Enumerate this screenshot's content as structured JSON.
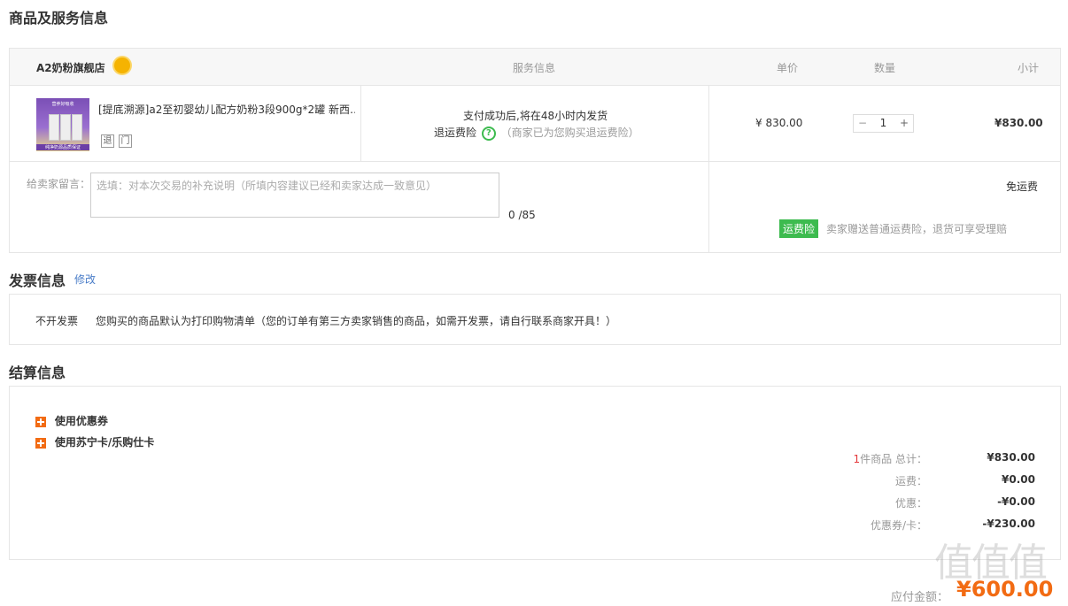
{
  "sections": {
    "goods_title": "商品及服务信息",
    "invoice_title": "发票信息",
    "invoice_edit": "修改",
    "settle_title": "结算信息"
  },
  "table": {
    "shop_name": "A2奶粉旗舰店",
    "col_service": "服务信息",
    "col_price": "单价",
    "col_qty": "数量",
    "col_subtotal": "小计"
  },
  "product": {
    "name": "[提底溯源]a2至初婴幼儿配方奶粉3段900g*2罐 新西…",
    "image_banner": "营养好吸收",
    "image_caption": "纯净奶源品质保证",
    "tag_return": "退",
    "tag_store": "门",
    "service_line1": "支付成功后,将在48小时内发货",
    "service_insurance_label": "退运费险",
    "service_insurance_note": "（商家已为您购买退运费险）",
    "unit_price": "¥ 830.00",
    "qty_minus": "−",
    "qty_value": "1",
    "qty_plus": "+",
    "subtotal": "¥830.00"
  },
  "message": {
    "label": "给卖家留言：",
    "placeholder": "选填：对本次交易的补充说明（所填内容建议已经和卖家达成一致意见）",
    "counter": "0 /85",
    "shipping": "免运费",
    "badge": "运费险",
    "badge_note": "卖家赠送普通运费险，退货可享受理赔"
  },
  "invoice": {
    "type": "不开发票",
    "note": "您购买的商品默认为打印购物清单（您的订单有第三方卖家销售的商品，如需开发票，请自行联系商家开具！）"
  },
  "settlement": {
    "coupon": "使用优惠券",
    "card": "使用苏宁卡/乐购仕卡",
    "count_number": "1",
    "count_text": "件商品 总计：",
    "total": "¥830.00",
    "freight_label": "运费：",
    "freight": "¥0.00",
    "discount_label": "优惠：",
    "discount": "-¥0.00",
    "coupon_label": "优惠券/卡：",
    "coupon_value": "-¥230.00",
    "pay_label": "应付金额：",
    "pay_value": "¥600.00"
  },
  "watermark": "值",
  "colors": {
    "orange": "#f26b13",
    "green": "#3dbb4f",
    "link": "#4a7dc8",
    "red_count": "#e4393c"
  }
}
